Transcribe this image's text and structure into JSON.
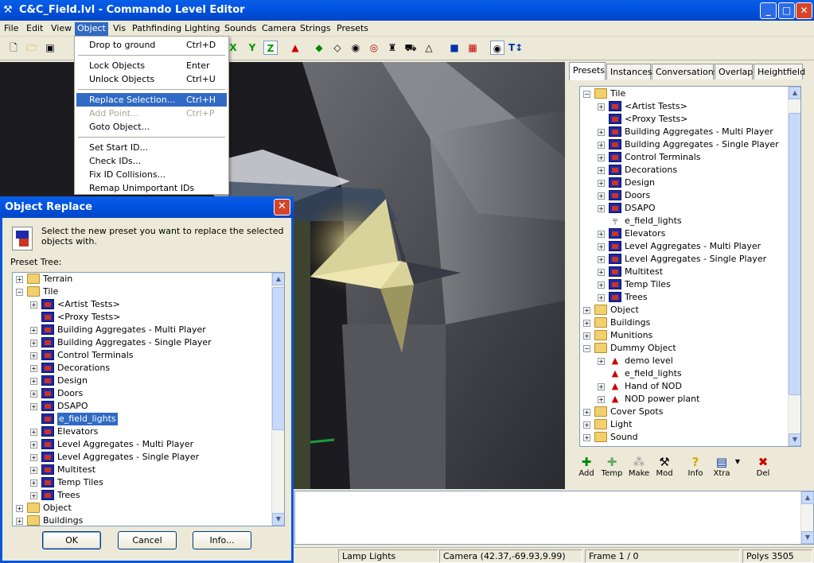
{
  "window": {
    "title": "C&C_Field.lvl - Commando Level Editor"
  },
  "menubar": [
    "File",
    "Edit",
    "View",
    "Object",
    "Vis",
    "Pathfinding",
    "Lighting",
    "Sounds",
    "Camera",
    "Strings",
    "Presets"
  ],
  "object_menu": {
    "items": [
      {
        "label": "Drop to ground",
        "key": "Ctrl+D"
      },
      {
        "label": "Lock Objects",
        "key": "Enter"
      },
      {
        "label": "Unlock Objects",
        "key": "Ctrl+U"
      },
      {
        "label": "Replace Selection...",
        "key": "Ctrl+H"
      },
      {
        "label": "Add Point...",
        "key": "Ctrl+P"
      },
      {
        "label": "Goto Object...",
        "key": ""
      },
      {
        "label": "Set Start ID...",
        "key": ""
      },
      {
        "label": "Check IDs...",
        "key": ""
      },
      {
        "label": "Fix ID Collisions...",
        "key": ""
      },
      {
        "label": "Remap Unimportant IDs",
        "key": ""
      }
    ]
  },
  "toolbar": {
    "axis_x": "X",
    "axis_y": "Y",
    "axis_z": "Z"
  },
  "panel": {
    "tabs": [
      "Presets",
      "Instances",
      "Conversations",
      "Overlap",
      "Heightfield"
    ],
    "tree": [
      "Tile",
      "<Artist Tests>",
      "<Proxy Tests>",
      "Building Aggregates - Multi Player",
      "Building Aggregates - Single Player",
      "Control Terminals",
      "Decorations",
      "Design",
      "Doors",
      "DSAPO",
      "e_field_lights",
      "Elevators",
      "Level Aggregates - Multi Player",
      "Level Aggregates - Single Player",
      "Multitest",
      "Temp Tiles",
      "Trees",
      "Object",
      "Buildings",
      "Munitions",
      "Dummy Object",
      "demo level",
      "e_field_lights",
      "Hand of NOD",
      "NOD power plant",
      "Cover Spots",
      "Light",
      "Sound"
    ],
    "buttons": [
      "Add",
      "Temp",
      "Make",
      "Mod",
      "Info",
      "Xtra",
      "Del"
    ]
  },
  "dialog": {
    "title": "Object Replace",
    "message": "Select the new preset you want to replace the selected objects with.",
    "tree_label": "Preset Tree:",
    "tree": [
      "Terrain",
      "Tile",
      "<Artist Tests>",
      "<Proxy Tests>",
      "Building Aggregates - Multi Player",
      "Building Aggregates - Single Player",
      "Control Terminals",
      "Decorations",
      "Design",
      "Doors",
      "DSAPO",
      "e_field_lights",
      "Elevators",
      "Level Aggregates - Multi Player",
      "Level Aggregates - Single Player",
      "Multitest",
      "Temp Tiles",
      "Trees",
      "Object",
      "Buildings"
    ],
    "ok": "OK",
    "cancel": "Cancel",
    "info": "Info..."
  },
  "status": {
    "item": "Lamp Lights",
    "camera": "Camera (42.37,-69.93,9.99)",
    "frame": "Frame 1 / 0",
    "polys": "Polys 3505"
  }
}
